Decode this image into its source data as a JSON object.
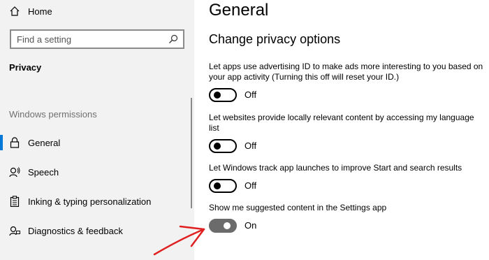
{
  "sidebar": {
    "home_label": "Home",
    "search_placeholder": "Find a setting",
    "heading": "Privacy",
    "section_label": "Windows permissions",
    "items": [
      {
        "label": "General",
        "icon": "lock-icon",
        "selected": true
      },
      {
        "label": "Speech",
        "icon": "speech-icon"
      },
      {
        "label": "Inking & typing personalization",
        "icon": "clipboard-icon"
      },
      {
        "label": "Diagnostics & feedback",
        "icon": "diagnostics-icon"
      }
    ]
  },
  "main": {
    "title": "General",
    "subtitle": "Change privacy options",
    "options": [
      {
        "text": "Let apps use advertising ID to make ads more interesting to you based on your app activity (Turning this off will reset your ID.)",
        "state": "Off"
      },
      {
        "text": "Let websites provide locally relevant content by accessing my language list",
        "state": "Off"
      },
      {
        "text": "Let Windows track app launches to improve Start and search results",
        "state": "Off"
      },
      {
        "text": "Show me suggested content in the Settings app",
        "state": "On"
      }
    ]
  },
  "colors": {
    "accent": "#0078d7",
    "annotation_arrow": "#e02020",
    "toggle_on": "#6b6b6b"
  }
}
